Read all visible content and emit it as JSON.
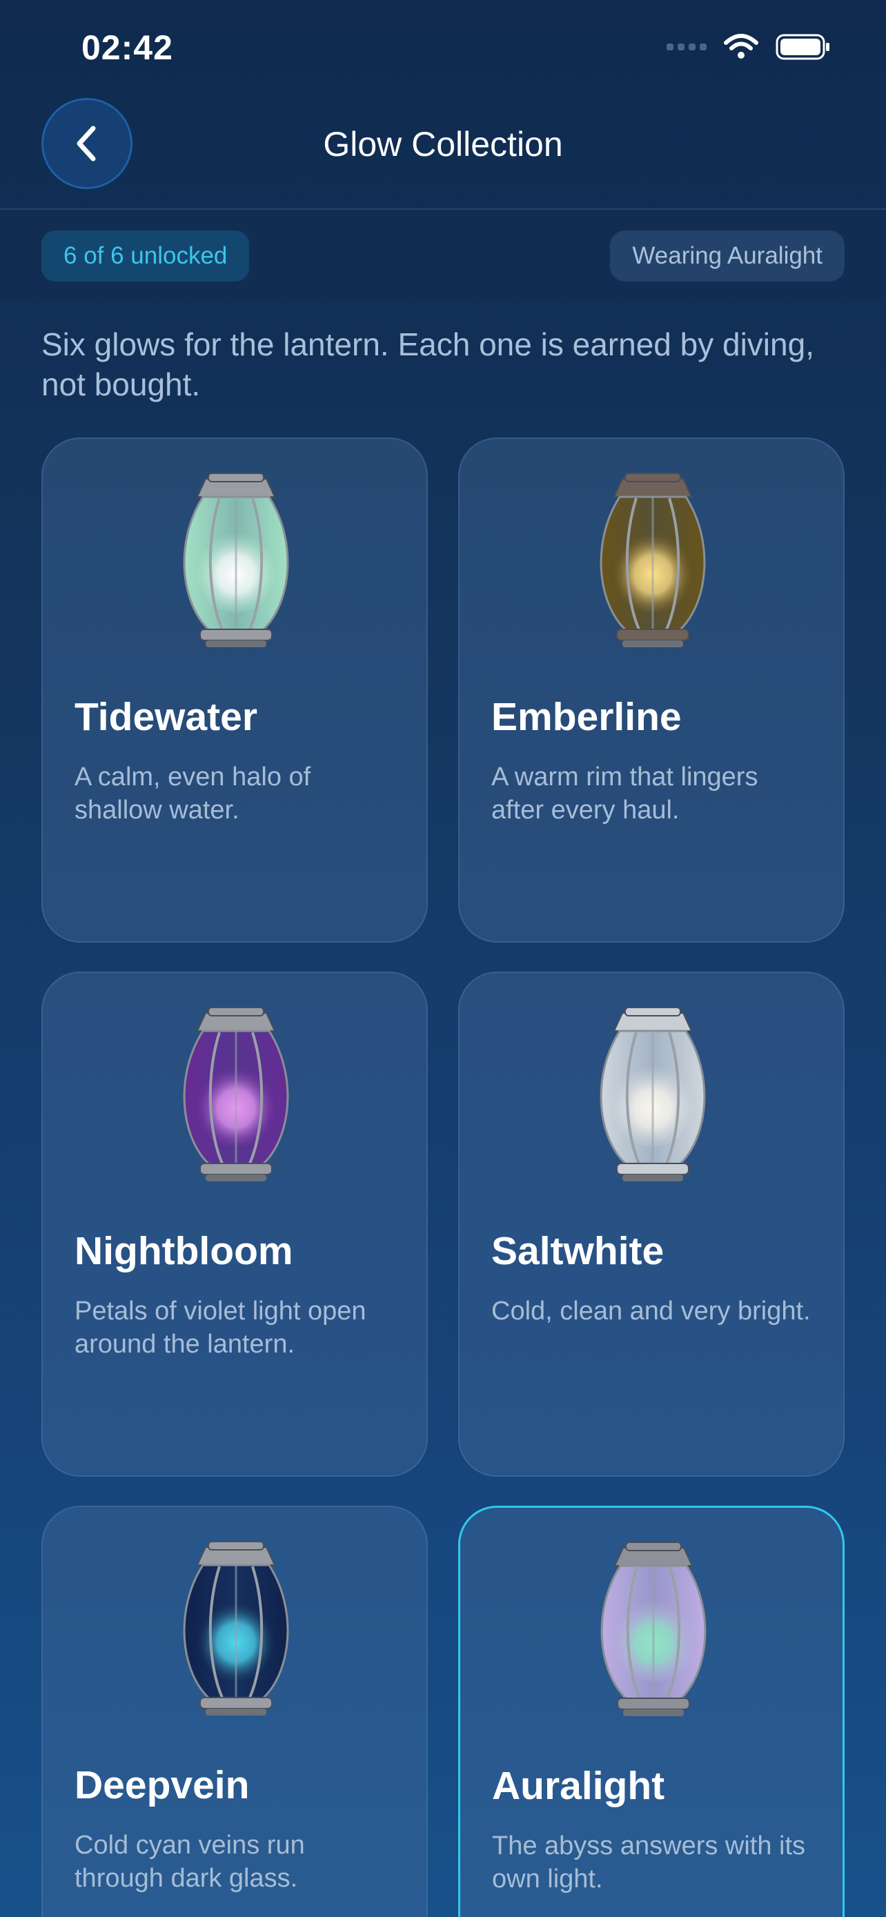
{
  "status": {
    "time": "02:42"
  },
  "nav": {
    "title": "Glow Collection",
    "back_icon": "chevron-left-icon"
  },
  "chips": {
    "unlocked": "6 of 6 unlocked",
    "wearing": "Wearing Auralight"
  },
  "intro": "Six glows for the lantern. Each one is earned by diving, not bought.",
  "colors": {
    "accent": "#2fc9ee",
    "background": "#0f2a4e"
  },
  "glows": [
    {
      "name": "Tidewater",
      "desc": "A calm, even halo of shallow water.",
      "glass": "#a9e8c9",
      "core": "#ffffff",
      "cap": "#9a9ea4",
      "selected": false
    },
    {
      "name": "Emberline",
      "desc": "A warm rim that lingers after every haul.",
      "glass": "#6b5418",
      "core": "#ffe08a",
      "cap": "#6e625a",
      "selected": false
    },
    {
      "name": "Nightbloom",
      "desc": "Petals of violet light open around the lantern.",
      "glass": "#6a2a96",
      "core": "#e69af3",
      "cap": "#9a9ea4",
      "selected": false
    },
    {
      "name": "Saltwhite",
      "desc": "Cold, clean and very bright.",
      "glass": "#d8dde2",
      "core": "#fbf7ee",
      "cap": "#c9ced4",
      "selected": false
    },
    {
      "name": "Deepvein",
      "desc": "Cold cyan veins run through dark glass.",
      "glass": "#0f1f4a",
      "core": "#4fd8f0",
      "cap": "#9a9ea4",
      "selected": false
    },
    {
      "name": "Auralight",
      "desc": "The abyss answers with its own light.",
      "glass": "#c6b2e6",
      "core": "#8fe6c4",
      "cap": "#8e9298",
      "selected": true
    }
  ]
}
